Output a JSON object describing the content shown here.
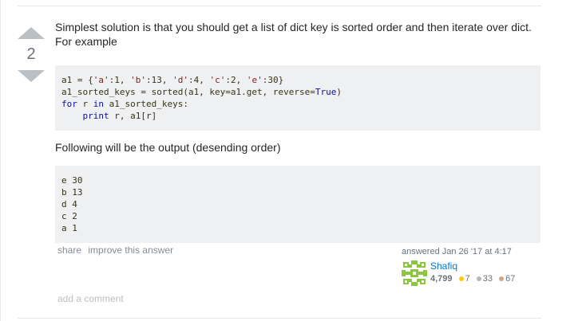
{
  "answer": {
    "vote_count": "2",
    "paragraph_1": "Simplest solution is that you should get a list of dict key is sorted order and then iterate over dict. For example",
    "code_1": {
      "line_1_a": "a1 = {",
      "line_1_s1": "'a'",
      "line_1_b": ":1, ",
      "line_1_s2": "'b'",
      "line_1_c": ":13, ",
      "line_1_s3": "'d'",
      "line_1_d": ":4, ",
      "line_1_s4": "'c'",
      "line_1_e": ":2, ",
      "line_1_s5": "'e'",
      "line_1_f": ":30}",
      "line_2_a": "a1_sorted_keys = sorted(a1, key=a1.get, reverse=",
      "line_2_lit": "True",
      "line_2_b": ")",
      "line_3_kw1": "for",
      "line_3_a": " r ",
      "line_3_kw2": "in",
      "line_3_b": " a1_sorted_keys:",
      "line_4_indent": "    ",
      "line_4_kw": "print",
      "line_4_a": " r, a1[r]"
    },
    "paragraph_2": "Following will be the output (desending order)",
    "code_2": {
      "lines": [
        "e 30",
        "b 13",
        "d 4",
        "c 2",
        "a 1"
      ]
    },
    "menu": {
      "share": "share",
      "improve": "improve this answer"
    },
    "user": {
      "action_time": "answered Jan 26 '17 at 4:17",
      "name": "Shafiq",
      "reputation": "4,799",
      "gold": "7",
      "silver": "33",
      "bronze": "67"
    },
    "add_comment": "add a comment"
  },
  "colors": {
    "link": "#0077cc",
    "code_bg": "#eff0f1",
    "vote_arrow": "#bbc0c4",
    "gravatar": "#8cc63e"
  },
  "icons": {
    "vote_up": "vote-up-arrow-icon",
    "vote_down": "vote-down-arrow-icon",
    "gravatar": "identicon-avatar"
  }
}
